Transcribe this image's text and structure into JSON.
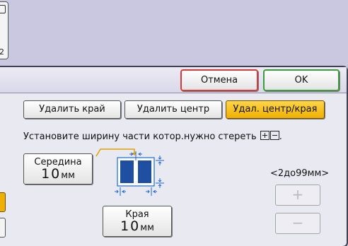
{
  "top_stub": {
    "icon": "document-icon",
    "number": "2"
  },
  "header": {
    "cancel_label": "Отмена",
    "ok_label": "OK"
  },
  "tabs": [
    {
      "label": "Удалить край",
      "selected": false
    },
    {
      "label": "Удалить центр",
      "selected": false
    },
    {
      "label": "Удал. центр/края",
      "selected": true
    }
  ],
  "instruction": "Установите ширину части котор.нужно стереть",
  "instruction_suffix": ".",
  "middle": {
    "label": "Середина",
    "value": "10",
    "unit": "мм"
  },
  "edge": {
    "label": "Края",
    "value": "10",
    "unit": "мм"
  },
  "range_label": "<2до99мм>",
  "stepper": {
    "plus": "+",
    "minus": "−"
  },
  "colors": {
    "accent": "#f0b000",
    "cancel_border": "#d63a3a",
    "ok_border": "#3d9a3d",
    "page_blue": "#1f4fa0",
    "arrow_blue": "#1a6ad0"
  }
}
